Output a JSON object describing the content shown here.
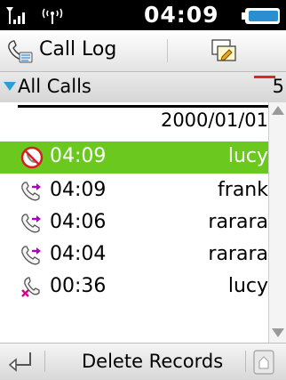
{
  "status": {
    "time": "04:09"
  },
  "title": {
    "label": "Call Log"
  },
  "filter": {
    "label": "All Calls",
    "count": "5"
  },
  "list": {
    "date": "2000/01/01",
    "rows": [
      {
        "time": "04:09",
        "name": "lucy",
        "type": "missed-call",
        "selected": true
      },
      {
        "time": "04:09",
        "name": "frank",
        "type": "outgoing-call",
        "selected": false
      },
      {
        "time": "04:06",
        "name": "rarara",
        "type": "outgoing-call",
        "selected": false
      },
      {
        "time": "04:04",
        "name": "rarara",
        "type": "outgoing-call",
        "selected": false
      },
      {
        "time": "00:36",
        "name": "lucy",
        "type": "rejected-call",
        "selected": false
      }
    ]
  },
  "softkeys": {
    "center": "Delete Records"
  },
  "colors": {
    "selection": "#6bc81f",
    "accent": "#2aa0d8",
    "missed": "#d42020"
  }
}
